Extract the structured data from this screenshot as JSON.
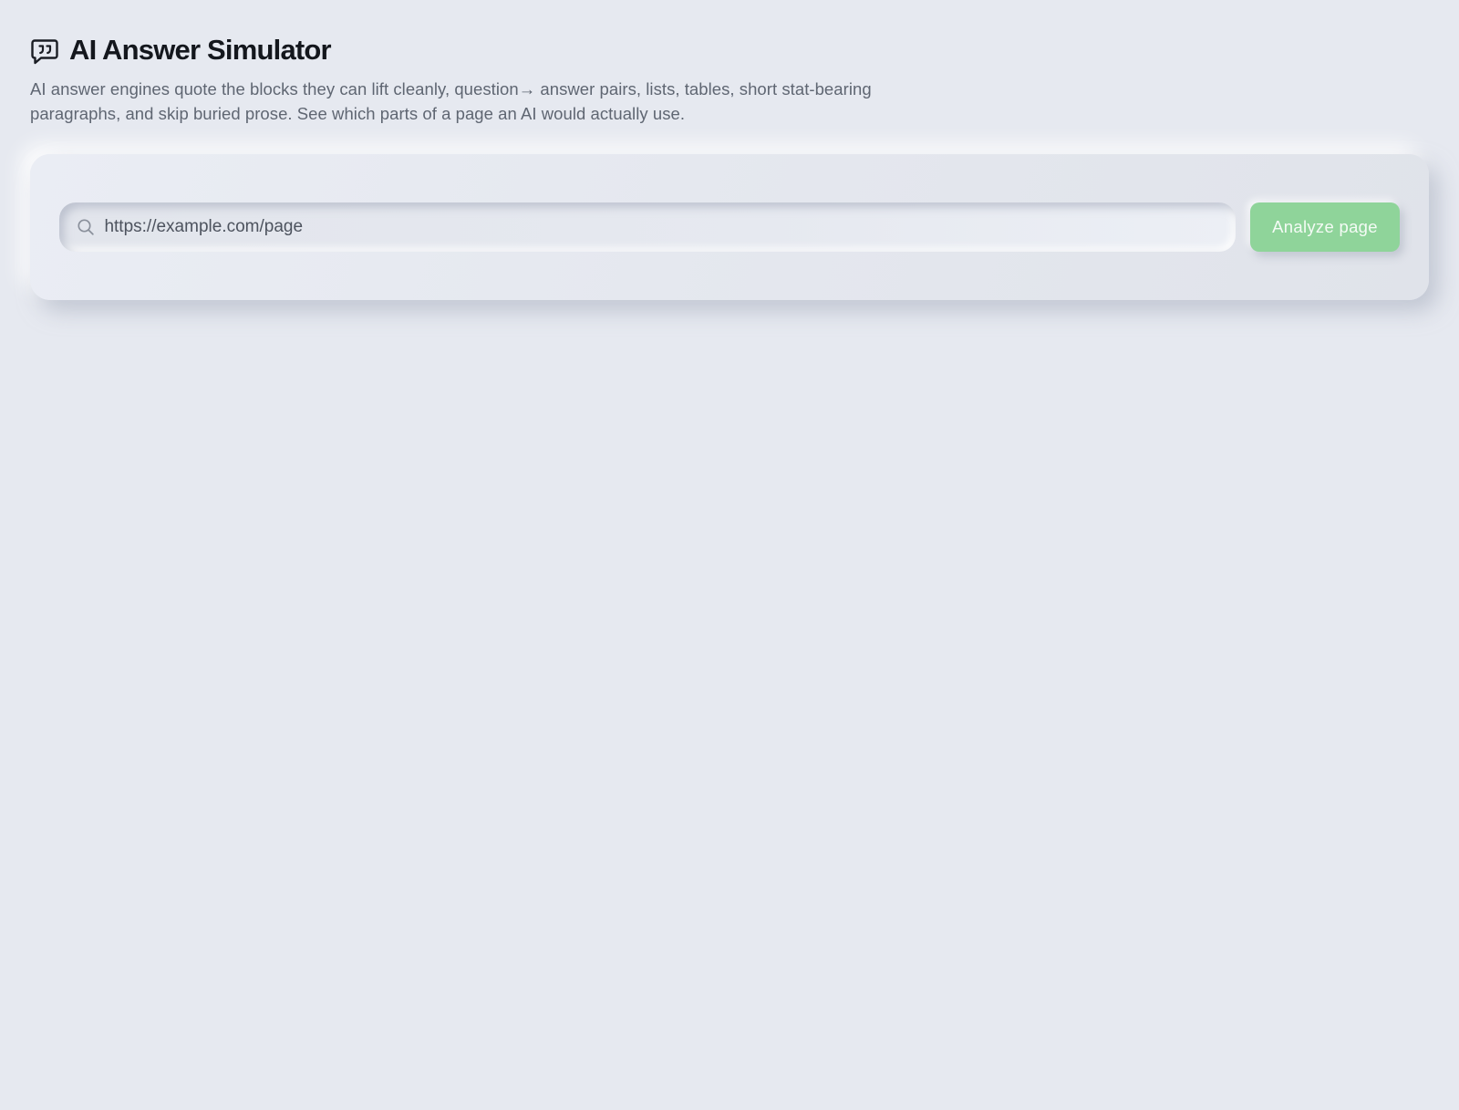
{
  "header": {
    "icon": "quote-bubble-icon",
    "title": "AI Answer Simulator",
    "subtitle_line1": "AI answer engines quote the blocks they can lift cleanly, question→ answer pairs, lists, tables, short stat-bearing",
    "subtitle_line2": "paragraphs, and skip buried prose. See which parts of a page an AI would actually use."
  },
  "search": {
    "icon": "search-icon",
    "placeholder": "https://example.com/page",
    "value": ""
  },
  "actions": {
    "analyze_label": "Analyze page"
  },
  "colors": {
    "background": "#e6e9f0",
    "accent_button": "#8fd49a",
    "title_text": "#14171d",
    "subtitle_text": "#5f6672"
  }
}
